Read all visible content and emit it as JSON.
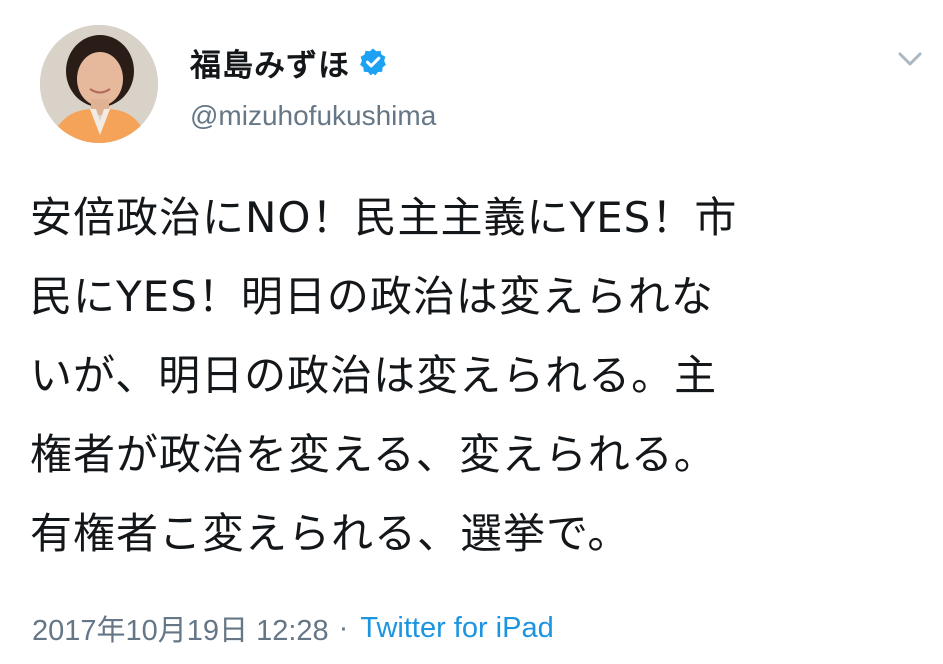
{
  "tweet": {
    "display_name": "福島みずほ",
    "handle": "@mizuhofukushima",
    "text_lines": [
      "安倍政治にNO！民主主義にYES！市",
      "民にYES！明日の政治は変えられな",
      "いが、明日の政治は変えられる。主",
      "権者が政治を変える、変えられる。",
      "有権者こ変えられる、選挙で。"
    ],
    "timestamp": "2017年10月19日 12:28",
    "separator": "·",
    "source": "Twitter for iPad",
    "icons": {
      "verified": "verified-badge-icon",
      "menu": "chevron-down-icon"
    },
    "colors": {
      "link": "#1b95e0",
      "secondary": "#657786",
      "verified": "#1da1f2",
      "text": "#14171a"
    }
  }
}
